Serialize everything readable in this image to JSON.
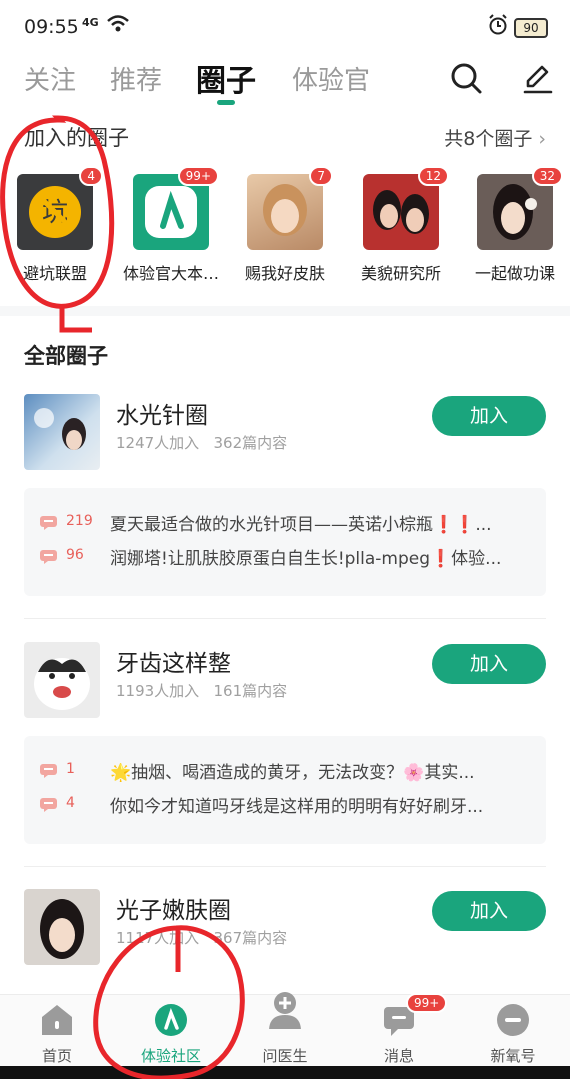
{
  "status": {
    "time": "09:55",
    "signal": "4G",
    "battery": "90"
  },
  "tabs": [
    {
      "label": "关注",
      "active": false
    },
    {
      "label": "推荐",
      "active": false
    },
    {
      "label": "圈子",
      "active": true
    },
    {
      "label": "体验官",
      "active": false
    }
  ],
  "icons": {
    "search": "search-icon",
    "edit": "edit-pen-icon"
  },
  "joined": {
    "title": "加入的圈子",
    "count": "共8个圈子",
    "items": [
      {
        "label": "避坑联盟",
        "badge": "4",
        "icon": "avoid-pit-icon"
      },
      {
        "label": "体验官大本…",
        "badge": "99+",
        "icon": "experience-officer-logo"
      },
      {
        "label": "赐我好皮肤",
        "badge": "7",
        "icon": "portrait-girl"
      },
      {
        "label": "美貌研究所",
        "badge": "12",
        "icon": "portrait-two-women"
      },
      {
        "label": "一起做功课",
        "badge": "32",
        "icon": "portrait-woman-flower"
      }
    ]
  },
  "all": {
    "title": "全部圈子",
    "join_label": "加入",
    "groups": [
      {
        "name": "水光针圈",
        "joined": "1247人加入",
        "content": "362篇内容",
        "posts": [
          {
            "count": "219",
            "text": "夏天最适合做的水光针项目——英诺小棕瓶❗❗..."
          },
          {
            "count": "96",
            "text": "润娜塔!让肌肤胶原蛋白自生长!plla-mpeg❗体验..."
          }
        ]
      },
      {
        "name": "牙齿这样整",
        "joined": "1193人加入",
        "content": "161篇内容",
        "posts": [
          {
            "count": "1",
            "text": "🌟抽烟、喝酒造成的黄牙，无法改变？🌸其实..."
          },
          {
            "count": "4",
            "text": "你如今才知道吗牙线是这样用的明明有好好刷牙..."
          }
        ]
      },
      {
        "name": "光子嫩肤圈",
        "joined": "1117人加入",
        "content": "367篇内容",
        "posts": []
      }
    ]
  },
  "nav": [
    {
      "label": "首页",
      "icon": "home-icon",
      "active": false
    },
    {
      "label": "体验社区",
      "icon": "community-icon",
      "active": true
    },
    {
      "label": "问医生",
      "icon": "doctor-icon",
      "active": false
    },
    {
      "label": "消息",
      "icon": "message-icon",
      "active": false,
      "badge": "99+"
    },
    {
      "label": "新氧号",
      "icon": "soyoung-icon",
      "active": false
    }
  ],
  "colors": {
    "accent": "#1aa57d",
    "badge": "#e8423e",
    "annotation": "#e8262b"
  }
}
